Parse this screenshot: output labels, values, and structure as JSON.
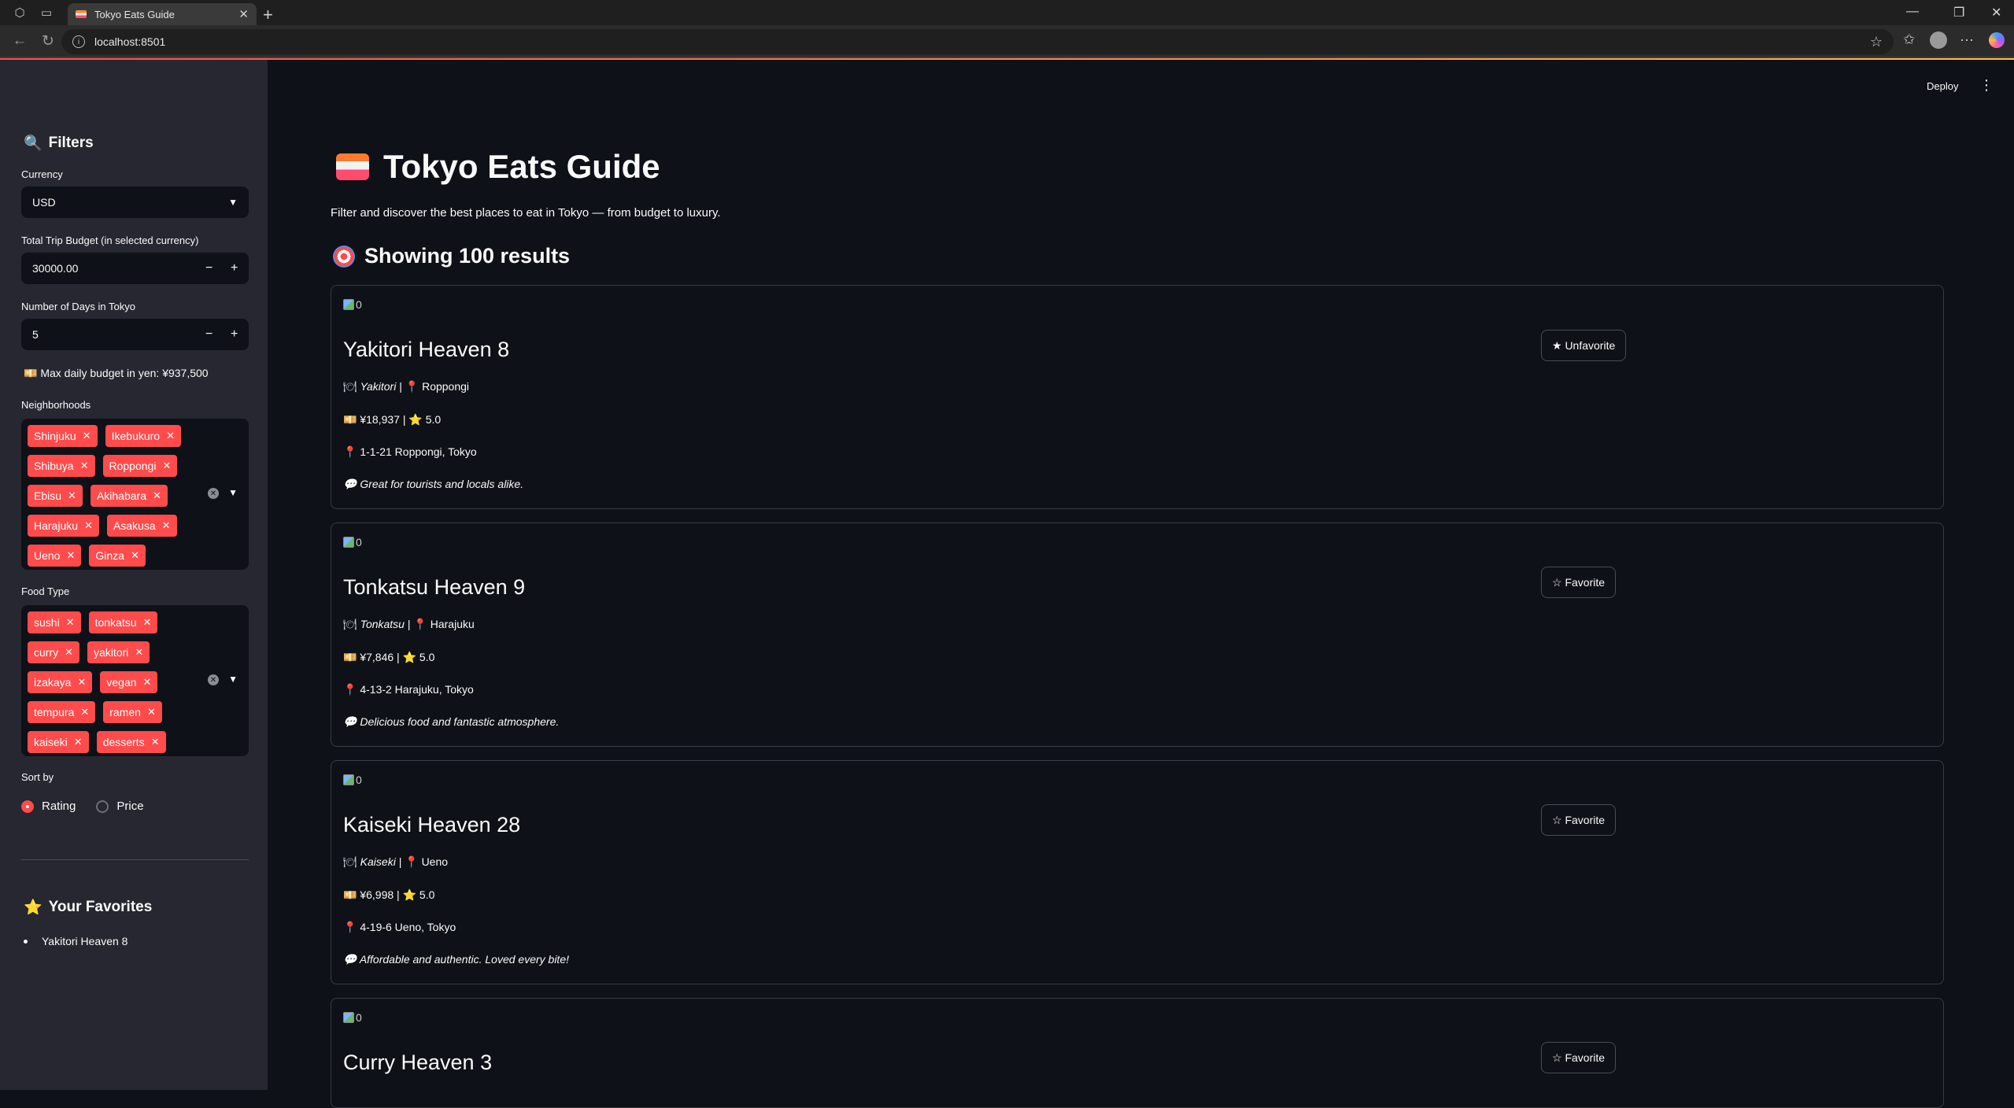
{
  "browser": {
    "tab_title": "Tokyo Eats Guide",
    "tab_close": "✕",
    "new_tab": "+",
    "url": "localhost:8501"
  },
  "header": {
    "deploy_label": "Deploy",
    "menu_icon": "⋮"
  },
  "sidebar": {
    "filters_heading": "Filters",
    "currency_label": "Currency",
    "currency_value": "USD",
    "budget_label": "Total Trip Budget (in selected currency)",
    "budget_value": "30000.00",
    "days_label": "Number of Days in Tokyo",
    "days_value": "5",
    "daily_budget_text": "Max daily budget in yen: ¥937,500",
    "neighborhoods_label": "Neighborhoods",
    "neighborhoods": [
      "Shinjuku",
      "Ikebukuro",
      "Shibuya",
      "Roppongi",
      "Ebisu",
      "Akihabara",
      "Harajuku",
      "Asakusa",
      "Ueno",
      "Ginza"
    ],
    "food_type_label": "Food Type",
    "food_types": [
      "sushi",
      "tonkatsu",
      "curry",
      "yakitori",
      "izakaya",
      "vegan",
      "tempura",
      "ramen",
      "kaiseki",
      "desserts"
    ],
    "sort_label": "Sort by",
    "sort_options": [
      "Rating",
      "Price"
    ],
    "sort_selected": "Rating",
    "favorites_heading": "Your Favorites",
    "favorites": [
      "Yakitori Heaven 8"
    ]
  },
  "main": {
    "title": "Tokyo Eats Guide",
    "subtitle": "Filter and discover the best places to eat in Tokyo — from budget to luxury.",
    "results_text": "Showing 100 results",
    "cards": [
      {
        "alt": "0",
        "name": "Yakitori Heaven 8",
        "food": "Yakitori",
        "area": "Roppongi",
        "price": "¥18,937",
        "rating": "5.0",
        "address": "1-1-21 Roppongi, Tokyo",
        "review": "Great for tourists and locals alike.",
        "button": "★ Unfavorite"
      },
      {
        "alt": "0",
        "name": "Tonkatsu Heaven 9",
        "food": "Tonkatsu",
        "area": "Harajuku",
        "price": "¥7,846",
        "rating": "5.0",
        "address": "4-13-2 Harajuku, Tokyo",
        "review": "Delicious food and fantastic atmosphere.",
        "button": "☆ Favorite"
      },
      {
        "alt": "0",
        "name": "Kaiseki Heaven 28",
        "food": "Kaiseki",
        "area": "Ueno",
        "price": "¥6,998",
        "rating": "5.0",
        "address": "4-19-6 Ueno, Tokyo",
        "review": "Affordable and authentic. Loved every bite!",
        "button": "☆ Favorite"
      },
      {
        "alt": "0",
        "name": "Curry Heaven 3",
        "button": "☆ Favorite"
      }
    ]
  }
}
